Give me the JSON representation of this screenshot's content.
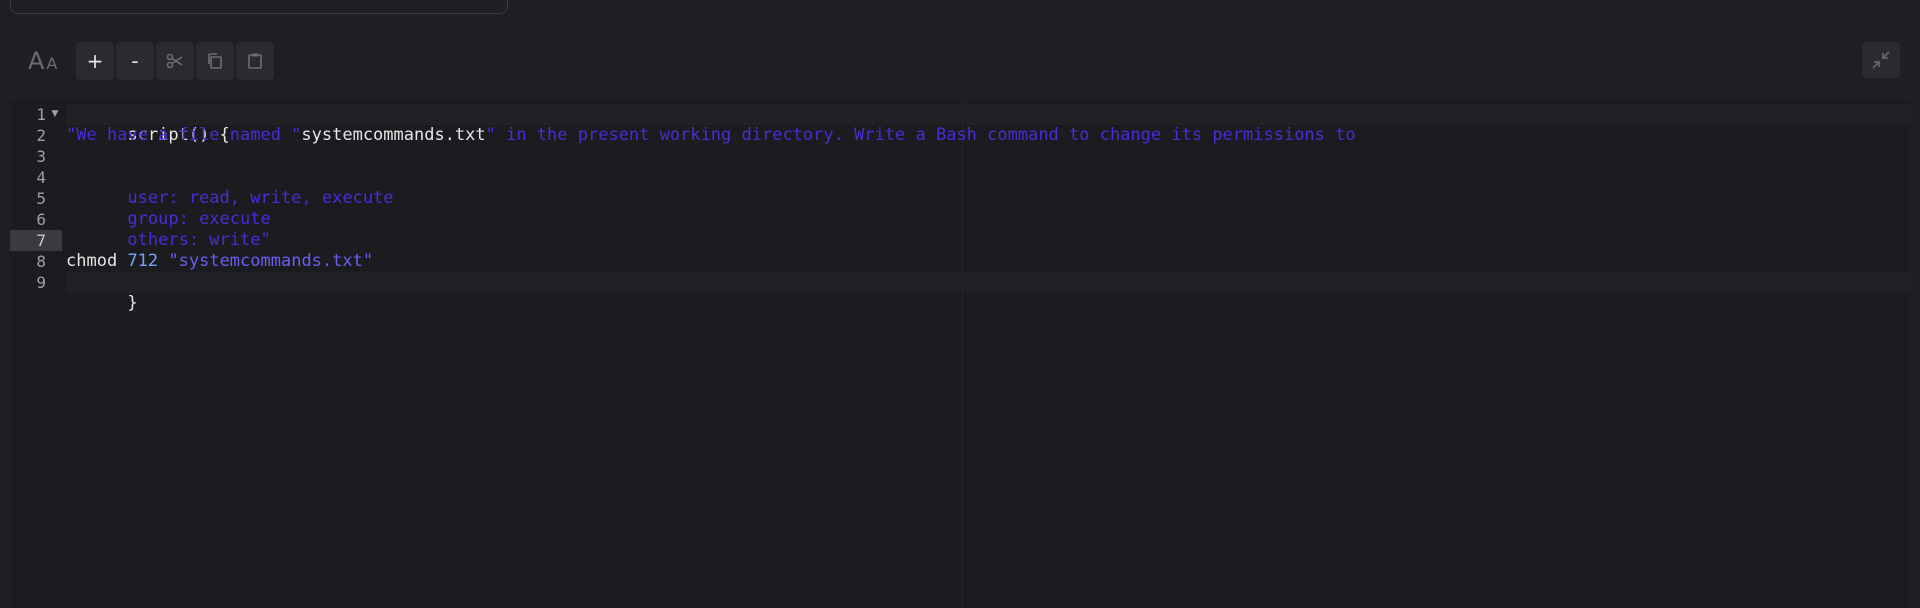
{
  "toolbar": {
    "font_size_big": "A",
    "font_size_small": "A",
    "zoom_in_label": "+",
    "zoom_out_label": "-",
    "icons": [
      "font-size-icon",
      "scissors-icon",
      "copy-icon",
      "clipboard-icon",
      "collapse-icon"
    ]
  },
  "editor": {
    "line_numbers": [
      "1",
      "2",
      "3",
      "4",
      "5",
      "6",
      "7",
      "8",
      "9"
    ],
    "active_line": 7,
    "line1": "script() {",
    "line2_open_quote": "\"We have a file named \"",
    "line2_filename": "systemcommands.txt",
    "line2_rest": "\" in the present working directory. Write a Bash command to change its permissions to",
    "line4": "user: read, write, execute",
    "line5": "group: execute",
    "line6": "others: write\"",
    "line8_cmd": "chmod ",
    "line8_num": "712",
    "line8_space": " ",
    "line8_str": "\"systemcommands.txt\"",
    "line9": "}"
  },
  "colors": {
    "background": "#1e1f22",
    "string": "#4b2bd6",
    "number": "#7aa2f7",
    "text": "#e6e6e6"
  }
}
